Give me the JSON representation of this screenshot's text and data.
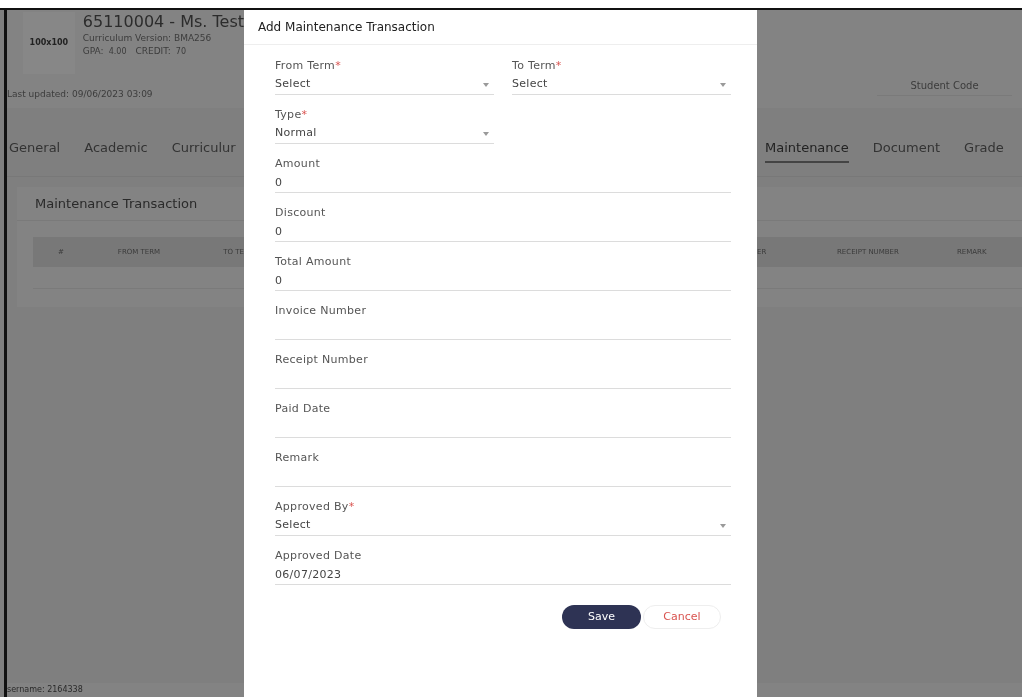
{
  "student": {
    "avatar_label": "100x100",
    "title": "65110004 - Ms. Test",
    "curriculum": "Curriculum Version: BMA256",
    "gpa_label": "GPA:",
    "gpa": "4.00",
    "credit_label": "CREDIT:",
    "credit": "70",
    "last_updated": "Last updated: 09/06/2023 03:09"
  },
  "student_code": {
    "placeholder": "Student Code"
  },
  "tabs_left": [
    {
      "label": "General",
      "selected": false
    },
    {
      "label": "Academic",
      "selected": false
    },
    {
      "label": "Curriculur",
      "selected": false
    }
  ],
  "tabs_right": [
    {
      "label": "Maintenance",
      "selected": true
    },
    {
      "label": "Document",
      "selected": false
    },
    {
      "label": "Grade",
      "selected": false
    }
  ],
  "card": {
    "title": "Maintenance Transaction",
    "columns_left": [
      "#",
      "FROM TERM",
      "TO TE"
    ],
    "columns_right": [
      "ER",
      "RECEIPT NUMBER",
      "REMARK"
    ]
  },
  "footer": "sername: 2164338",
  "dialog": {
    "title": "Add Maintenance Transaction",
    "required_mark": "*",
    "rows": [
      [
        {
          "label": "From Term",
          "required": true,
          "kind": "half-select",
          "value": "Select"
        },
        {
          "label": "To Term",
          "required": true,
          "kind": "half-select",
          "value": "Select"
        }
      ],
      [
        {
          "label": "Type",
          "required": true,
          "kind": "half-select",
          "value": "Normal"
        }
      ],
      [
        {
          "label": "Amount",
          "required": false,
          "kind": "input",
          "value": "0"
        }
      ],
      [
        {
          "label": "Discount",
          "required": false,
          "kind": "input",
          "value": "0"
        }
      ],
      [
        {
          "label": "Total Amount",
          "required": false,
          "kind": "input",
          "value": "0"
        }
      ],
      [
        {
          "label": "Invoice Number",
          "required": false,
          "kind": "input"
        }
      ],
      [
        {
          "label": "Receipt Number",
          "required": false,
          "kind": "input"
        }
      ],
      [
        {
          "label": "Paid Date",
          "required": false,
          "kind": "input"
        }
      ],
      [
        {
          "label": "Remark",
          "required": false,
          "kind": "input"
        }
      ],
      [
        {
          "label": "Approved By",
          "required": true,
          "kind": "select",
          "value": "Select"
        }
      ],
      [
        {
          "label": "Approved Date",
          "required": false,
          "kind": "input",
          "value": "06/07/2023"
        }
      ]
    ],
    "save": "Save",
    "cancel": "Cancel"
  }
}
